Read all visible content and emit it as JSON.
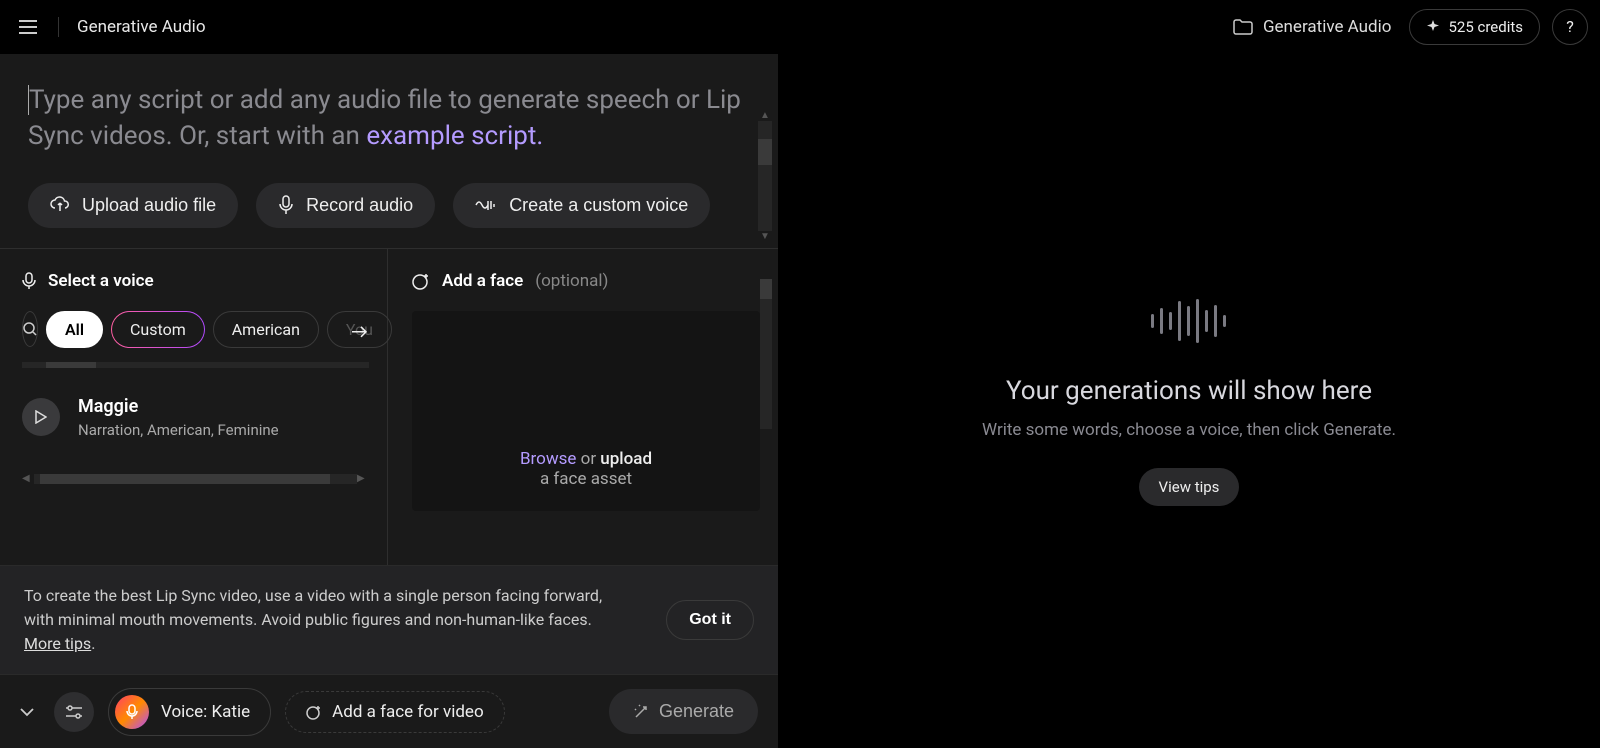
{
  "header": {
    "title": "Generative Audio",
    "folder_label": "Generative Audio",
    "credits_label": "525 credits",
    "help_glyph": "?"
  },
  "script": {
    "placeholder_part1": "Type any script or add any audio file to generate speech or Lip Sync videos. Or, start with an ",
    "example_link": "example script.",
    "buttons": {
      "upload": "Upload audio file",
      "record": "Record audio",
      "custom_voice": "Create a custom voice"
    }
  },
  "voice_panel": {
    "title": "Select a voice",
    "chips": [
      "All",
      "Custom",
      "American",
      "You"
    ],
    "voice": {
      "name": "Maggie",
      "desc": "Narration, American, Feminine"
    }
  },
  "face_panel": {
    "title": "Add a face",
    "optional": "(optional)",
    "drop_browse": "Browse",
    "drop_or": " or ",
    "drop_upload": "upload",
    "drop_line2": "a face asset"
  },
  "tip": {
    "text": "To create the best Lip Sync video, use a video with a single person facing forward, with minimal mouth movements. Avoid public figures and non-human-like faces. ",
    "more": "More tips",
    "gotit": "Got it"
  },
  "bottom": {
    "voice_label": "Voice: Katie",
    "add_face_label": "Add a face for video",
    "generate": "Generate"
  },
  "right": {
    "title": "Your generations will show here",
    "sub": "Write some words, choose a voice, then click Generate.",
    "view_tips": "View tips"
  }
}
